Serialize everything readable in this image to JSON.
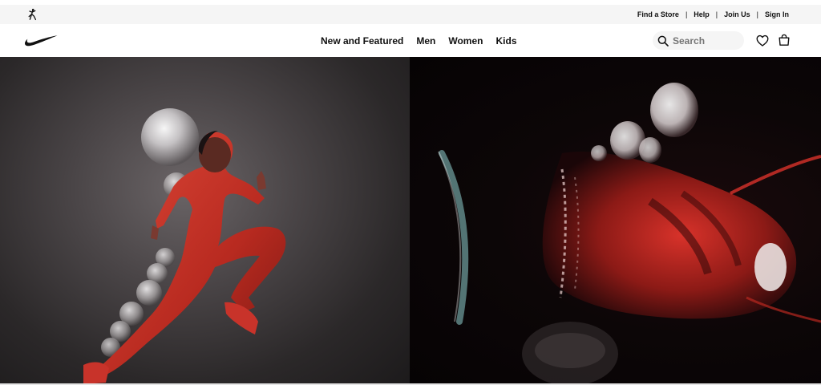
{
  "utility_bar": {
    "brand_logo": "jordan-jumpman-icon",
    "links": [
      {
        "label": "Find a Store"
      },
      {
        "label": "Help"
      },
      {
        "label": "Join Us"
      },
      {
        "label": "Sign In"
      }
    ],
    "separator": "|"
  },
  "main_nav": {
    "brand_logo": "nike-swoosh-icon",
    "links": [
      {
        "label": "New and Featured"
      },
      {
        "label": "Men"
      },
      {
        "label": "Women"
      },
      {
        "label": "Kids"
      }
    ],
    "search": {
      "placeholder": "Search",
      "value": "",
      "icon": "search-icon"
    },
    "icons": [
      "heart-icon",
      "bag-icon"
    ]
  },
  "hero": {
    "left_image": "athlete-in-red-bodysuit-jumping",
    "right_image": "red-shoe-closeup",
    "accent_color": "#c8281e",
    "left_background": "#4a4547",
    "right_background": "#0c0607"
  }
}
